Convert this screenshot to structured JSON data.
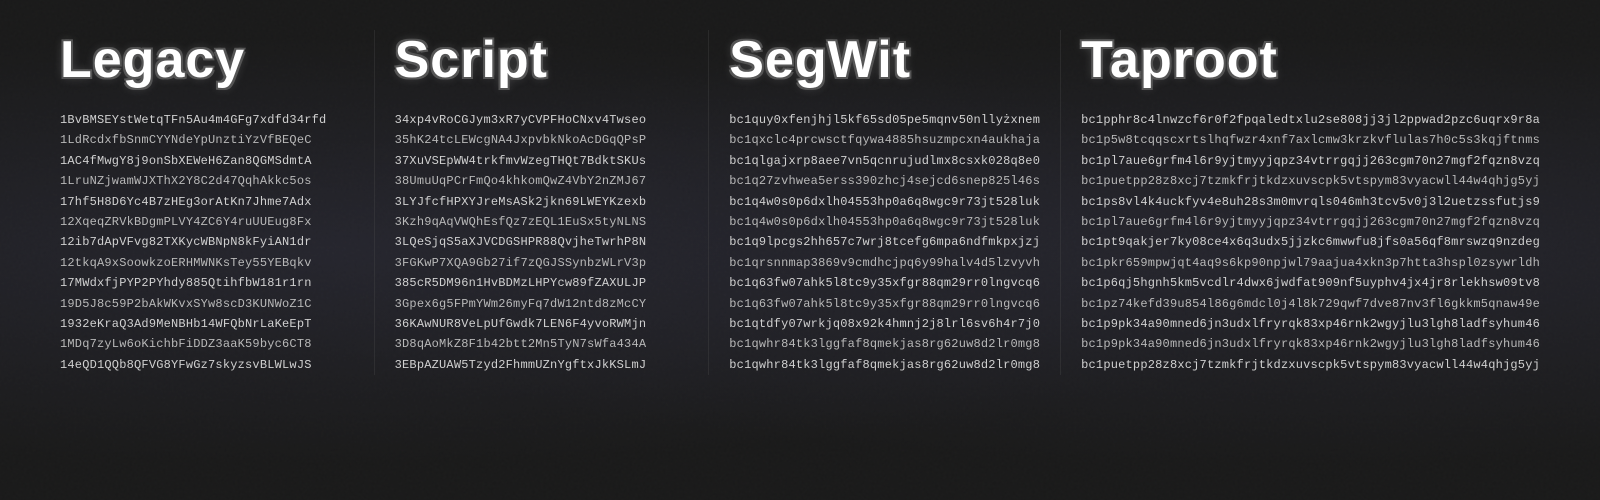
{
  "columns": [
    {
      "id": "legacy",
      "header": "Legacy",
      "addresses": [
        "1BvBMSEYstWetqTFn5Au4m4GFg7xdfd34rfd",
        "1LdRcdxfbSnmCYYNdeYpUnztiYzVfBEQeC",
        "1AC4fMwgY8j9onSbXEWeH6Zan8QGMSdmtA",
        "1LruNZjwamWJXThX2Y8C2d47QqhAkkc5os",
        "17hf5H8D6Yc4B7zHEg3orAtKn7Jhme7Adx",
        "12XqeqZRVkBDgmPLVY4ZC6Y4ruUUEug8Fx",
        "12ib7dApVFvg82TXKycWBNpN8kFyiAN1dr",
        "12tkqA9xSoowkzoERHMWNKsTey55YEBqkv",
        "17MWdxfjPYP2PYhdy885QtihfbW181r1rn",
        "19D5J8c59P2bAkWKvxSYw8scD3KUNWoZ1C",
        "1932eKraQ3Ad9MeNBHb14WFQbNrLaKeEpT",
        "1MDq7zyLw6oKichbFiDDZ3aaK59byc6CT8",
        "14eQD1QQb8QFVG8YFwGz7skyzsvBLWLwJS"
      ]
    },
    {
      "id": "script",
      "header": "Script",
      "addresses": [
        "34xp4vRoCGJym3xR7yCVPFHoCNxv4Twseo",
        "35hK24tcLEWcgNA4JxpvbkNkoAcDGqQPsP",
        "37XuVSEpWW4trkfmvWzegTHQt7BdktSKUs",
        "38UmuUqPCrFmQo4khkomQwZ4VbY2nZMJ67",
        "3LYJfcfHPXYJreMsASk2jkn69LWEYKzexb",
        "3Kzh9qAqVWQhEsfQz7zEQL1EuSx5tyNLNS",
        "3LQeSjqS5aXJVCDGSHPR88QvjheTwrhP8N",
        "3FGKwP7XQA9Gb27if7zQGJSSynbzWLrV3p",
        "385cR5DM96n1HvBDMzLHPYcw89fZAXULJP",
        "3Gpex6g5FPmYWm26myFq7dW12ntd8zMcCY",
        "36KAwNUR8VeLpUfGwdk7LEN6F4yvoRWMjn",
        "3D8qAoMkZ8F1b42btt2Mn5TyN7sWfa434A",
        "3EBpAZUAW5Tzyd2FhmmUZnYgftxJkKSLmJ"
      ]
    },
    {
      "id": "segwit",
      "header": "SegWit",
      "addresses": [
        "bc1quy0xfenjhjl5kf65sd05pe5mqnv50nllyżxnem",
        "bc1qxclc4prcwsctfqywa4885hsuzmpcxn4aukhaja",
        "bc1qlgajxrp8aee7vn5qcnrujudlmx8csxk028q8e0",
        "bc1q27zvhwea5erss390zhcj4sejcd6snep825l46s",
        "bc1q4w0s0p6dxlh04553hp0a6q8wgc9r73jt528luk",
        "bc1q4w0s0p6dxlh04553hp0a6q8wgc9r73jt528luk",
        "bc1q9lpcgs2hh657c7wrj8tcefg6mpa6ndfmkpxjzj",
        "bc1qrsnnmap3869v9cmdhcjpq6y99halv4d5lzvyvh",
        "bc1q63fw07ahk5l8tc9y35xfgr88qm29rr0lngvcq6",
        "bc1q63fw07ahk5l8tc9y35xfgr88qm29rr0lngvcq6",
        "bc1qtdfy07wrkjq08x92k4hmnj2j8lrl6sv6h4r7j0",
        "bc1qwhr84tk3lggfaf8qmekjas8rg62uw8d2lr0mg8",
        "bc1qwhr84tk3lggfaf8qmekjas8rg62uw8d2lr0mg8"
      ]
    },
    {
      "id": "taproot",
      "header": "Taproot",
      "addresses": [
        "bc1pphr8c4lnwzcf6r0f2fpqaledtxlu2se808jj3jl2ppwad2pzc6uqrx9r8a",
        "bc1p5w8tcqqscxrtslhqfwzr4xnf7axlcmw3krzkvflulas7h0c5s3kqjftnms",
        "bc1pl7aue6grfm4l6r9yjtmyyjqpz34vtrrgqjj263cgm70n27mgf2fqzn8vzq",
        "bc1puetpp28z8xcj7tzmkfrjtkdzxuvscpk5vtspym83vyacwll44w4qhjg5yj",
        "bc1ps8vl4k4uckfyv4e8uh28s3m0mvrqls046mh3tcv5v0j3l2uetzssfutjs9",
        "bc1pl7aue6grfm4l6r9yjtmyyjqpz34vtrrgqjj263cgm70n27mgf2fqzn8vzq",
        "bc1pt9qakjer7ky08ce4x6q3udx5jjzkc6mwwfu8jfs0a56qf8mrswzq9nzdeg",
        "bc1pkr659mpwjqt4aq9s6kp90npjwl79aajua4xkn3p7htta3hspl0zsywrldh",
        "bc1p6qj5hgnh5km5vcdlr4dwx6jwdfat909nf5uyphv4jx4jr8rlekhsw09tv8",
        "bc1pz74kefd39u854l86g6mdcl0j4l8k729qwf7dve87nv3fl6gkkm5qnaw49e",
        "bc1p9pk34a90mned6jn3udxlfryrqk83xp46rnk2wgyjlu3lgh8ladfsyhum46",
        "bc1p9pk34a90mned6jn3udxlfryrqk83xp46rnk2wgyjlu3lgh8ladfsyhum46",
        "bc1puetpp28z8xcj7tzmkfrjtkdzxuvscpk5vtspym83vyacwll44w4qhjg5yj"
      ]
    }
  ]
}
